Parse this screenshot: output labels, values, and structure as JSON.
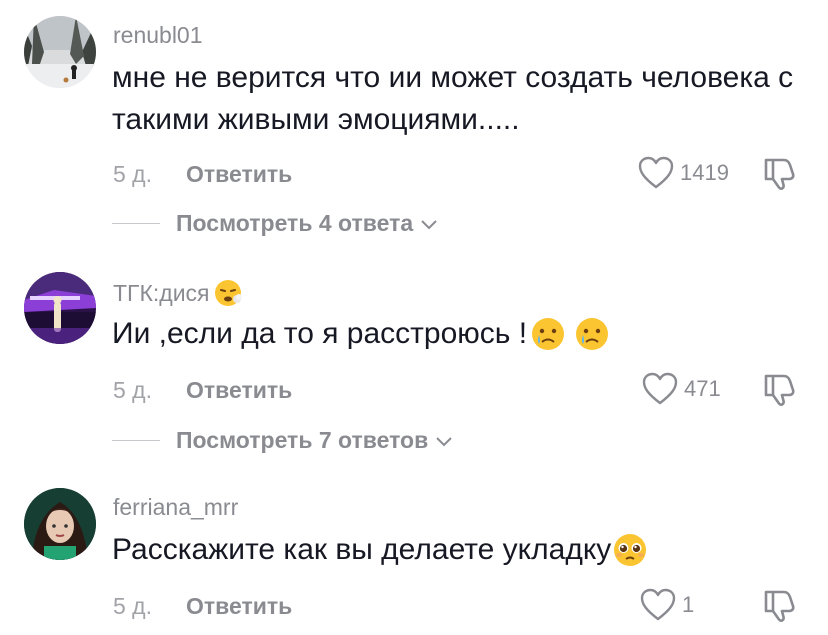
{
  "comments": [
    {
      "username": "renubl01",
      "text": "мне не верится что ии может создать человека с такими живыми эмоциями.....",
      "time": "5 д.",
      "reply_label": "Ответить",
      "likes": "1419",
      "view_replies": "Посмотреть 4 ответа"
    },
    {
      "username": "ТГК:дися",
      "text": "Ии ,если да то я расстроюсь !",
      "time": "5 д.",
      "reply_label": "Ответить",
      "likes": "471",
      "view_replies": "Посмотреть 7 ответов"
    },
    {
      "username": "ferriana_mrr",
      "text": "Расскажите как вы делаете укладку",
      "time": "5 д.",
      "reply_label": "Ответить",
      "likes": "1"
    }
  ],
  "icons": {
    "like": "heart-outline-icon",
    "dislike": "thumbs-down-outline-icon",
    "expand": "chevron-down-icon"
  },
  "colors": {
    "text": "#161823",
    "secondary": "#8a8b91",
    "divider": "#c8c9cc"
  }
}
